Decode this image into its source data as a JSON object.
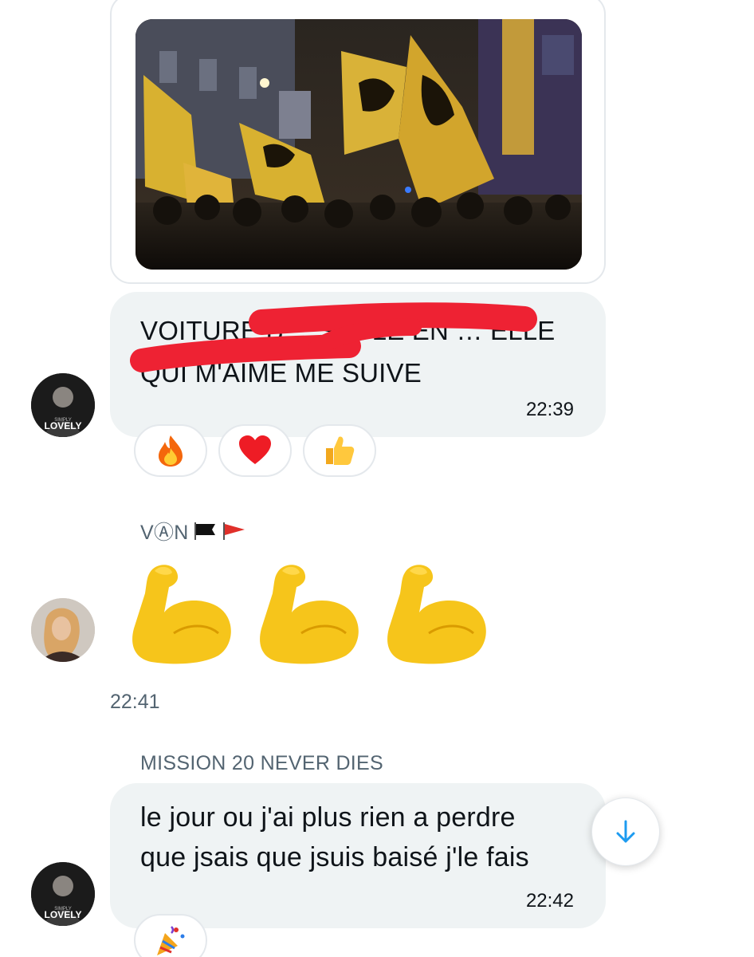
{
  "message_1": {
    "text": "VOITURE B… SEULE EN … ELLE QUI M'AIME ME SUIVE",
    "time": "22:39",
    "reactions": [
      "fire",
      "red-heart",
      "thumbs-up"
    ]
  },
  "message_2": {
    "sender": "VⒶN",
    "sender_icons": [
      "black-flag",
      "red-flag"
    ],
    "emojis": [
      "flexed-biceps",
      "flexed-biceps",
      "flexed-biceps"
    ],
    "time": "22:41"
  },
  "message_3": {
    "sender": "MISSION 20 NEVER DIES",
    "text_line_1": "le jour ou j'ai plus rien a perdre",
    "text_line_2": "que jsais que jsuis baisé j'le fais",
    "time": "22:42",
    "reactions": [
      "party-popper"
    ]
  },
  "colors": {
    "bubble": "#eff3f4",
    "secondary_text": "#536471",
    "accent_blue": "#1d9bf0",
    "redaction": "#ee2233"
  }
}
